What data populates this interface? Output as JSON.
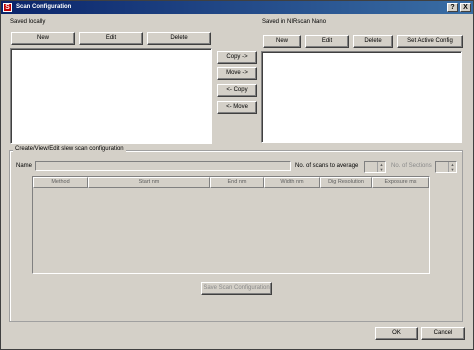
{
  "window": {
    "title": "Scan Configuration",
    "help_glyph": "?",
    "close_glyph": "X",
    "icon_glyph": "S"
  },
  "left": {
    "label": "Saved locally",
    "buttons": {
      "new": "New",
      "edit": "Edit",
      "delete": "Delete"
    }
  },
  "middle": {
    "copy_right": "Copy ->",
    "move_right": "Move ->",
    "copy_left": "<- Copy",
    "move_left": "<- Move"
  },
  "right": {
    "label": "Saved in NIRscan Nano",
    "buttons": {
      "new": "New",
      "edit": "Edit",
      "delete": "Delete",
      "set_active": "Set Active Config"
    }
  },
  "editor": {
    "group_title": "Create/View/Edit  slew scan configuration",
    "name_label": "Name",
    "name_value": "",
    "scans_label": "No. of scans to average",
    "sections_label": "No. of Sections",
    "spin_up": "▲",
    "spin_down": "▼",
    "table_headers": [
      "Method",
      "Start nm",
      "End nm",
      "Width nm",
      "Dig Resolution",
      "Exposure ms"
    ],
    "save_button": "Save Scan Configuration"
  },
  "footer": {
    "ok": "OK",
    "cancel": "Cancel"
  }
}
